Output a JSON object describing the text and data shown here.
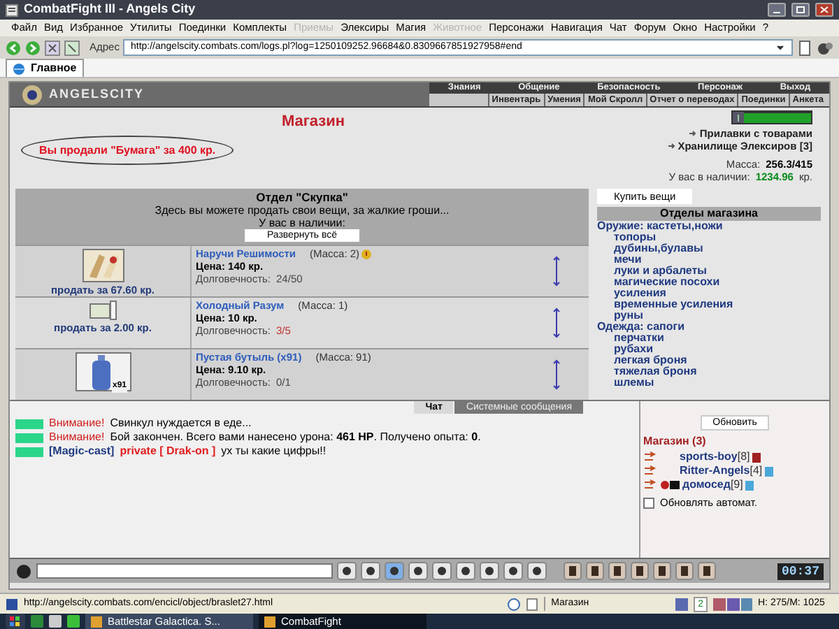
{
  "window": {
    "title": "CombatFight III - Angels City"
  },
  "menu": [
    {
      "label": "Файл",
      "disabled": false
    },
    {
      "label": "Вид",
      "disabled": false
    },
    {
      "label": "Избранное",
      "disabled": false
    },
    {
      "label": "Утилиты",
      "disabled": false
    },
    {
      "label": "Поединки",
      "disabled": false
    },
    {
      "label": "Комплекты",
      "disabled": false
    },
    {
      "label": "Приемы",
      "disabled": true
    },
    {
      "label": "Элексиры",
      "disabled": false
    },
    {
      "label": "Магия",
      "disabled": false
    },
    {
      "label": "Животное",
      "disabled": true
    },
    {
      "label": "Персонажи",
      "disabled": false
    },
    {
      "label": "Навигация",
      "disabled": false
    },
    {
      "label": "Чат",
      "disabled": false
    },
    {
      "label": "Форум",
      "disabled": false
    },
    {
      "label": "Окно",
      "disabled": false
    },
    {
      "label": "Настройки",
      "disabled": false
    },
    {
      "label": "?",
      "disabled": false
    }
  ],
  "address": {
    "label": "Адрес",
    "value": "http://angelscity.combats.com/logs.pl?log=1250109252.96684&0.8309667851927958#end"
  },
  "tabs": [
    {
      "label": "Главное",
      "selected": true
    }
  ],
  "game_nav": {
    "logo": "ANGELSCITY",
    "top": [
      "Знания",
      "Общение",
      "Безопасность",
      "Персонаж",
      "Выход"
    ],
    "sub": [
      "Инвентарь",
      "Умения",
      "Мой Скролл",
      "Отчет о переводах",
      "Поединки",
      "Анкета"
    ]
  },
  "shop": {
    "title": "Магазин",
    "notice": "Вы продали \"Бумага\" за 400 кр.",
    "links": [
      "Прилавки с товарами",
      "Хранилище Элексиров [3]"
    ],
    "mass_label": "Масса:",
    "mass": "256.3/415",
    "money_label": "У вас в наличии:",
    "money": "1234.96",
    "currency": "кр."
  },
  "department": {
    "title": "Отдел \"Скупка\"",
    "description": "Здесь вы можете продать свои вещи, за жалкие гроши...",
    "available": "У вас в наличии:",
    "expand_button": "Развернуть всё"
  },
  "items": [
    {
      "kind": "bracers",
      "name": "Наручи Решимости",
      "mass": "(Масса: 2)",
      "price": "Цена: 140 кр.",
      "durability_label": "Долговечность:",
      "durability": "24/50",
      "worn": false,
      "gift": true,
      "sell": "продать за 67.60 кр."
    },
    {
      "kind": "scroll",
      "name": "Холодный Разум",
      "mass": "(Масса: 1)",
      "price": "Цена: 10 кр.",
      "durability_label": "Долговечность:",
      "durability": "3/5",
      "worn": true,
      "gift": false,
      "sell": "продать за 2.00 кр."
    },
    {
      "kind": "bottle",
      "name": "Пустая бутыль (x91)",
      "mass": "(Масса: 91)",
      "price": "Цена: 9.10 кр.",
      "durability_label": "Долговечность:",
      "durability": "0/1",
      "worn": false,
      "gift": false,
      "count": "x91"
    }
  ],
  "buy_button": "Купить вещи",
  "sections_title": "Отделы магазина",
  "sections": [
    {
      "label": "Оружие: кастеты,ножи",
      "children": [
        {
          "label": "топоры"
        },
        {
          "label": "дубины,булавы"
        },
        {
          "label": "мечи"
        },
        {
          "label": "луки и арбалеты"
        },
        {
          "label": "магические посохи"
        },
        {
          "label": "усиления"
        },
        {
          "label": "временные усиления"
        },
        {
          "label": "руны"
        }
      ]
    },
    {
      "label": "Одежда: сапоги",
      "children": [
        {
          "label": "перчатки"
        },
        {
          "label": "рубахи"
        },
        {
          "label": "легкая броня"
        },
        {
          "label": "тяжелая броня"
        },
        {
          "label": "шлемы"
        }
      ]
    }
  ],
  "chat": {
    "tabs": [
      {
        "label": "Чат",
        "selected": true
      },
      {
        "label": "Системные сообщения",
        "selected": false
      }
    ],
    "messages": [
      {
        "kind": "warning",
        "prefix": "Внимание!",
        "text": "Свинкул нуждается в еде..."
      },
      {
        "kind": "warning",
        "prefix": "Внимание!",
        "text": "Бой закончен. Всего вами нанесено урона: **461 HP**. Получено опыта: **0**."
      },
      {
        "kind": "private",
        "sender": "[Magic-cast]",
        "to": "private [ Drak-on ]",
        "text": "ух ты какие цифры!!"
      }
    ]
  },
  "online": {
    "refresh_button": "Обновить",
    "title": "Магазин (3)",
    "users": [
      {
        "name": "sports-boy",
        "level": "[8]"
      },
      {
        "name": "Ritter-Angels",
        "level": "[4]"
      },
      {
        "name": "домосед",
        "level": "[9]"
      }
    ],
    "auto_refresh": {
      "label": "Обновлять автомат.",
      "checked": false
    }
  },
  "clock": "00:37",
  "status_bar": {
    "url": "http://angelscity.combats.com/encicl/object/braslet27.html",
    "zone": "Магазин",
    "badge": "2",
    "hp": "H: 275/M: 1025"
  },
  "taskbar": [
    {
      "label": "Battlestar Galactica. S...",
      "selected": false
    },
    {
      "label": "CombatFight",
      "selected": true
    }
  ]
}
